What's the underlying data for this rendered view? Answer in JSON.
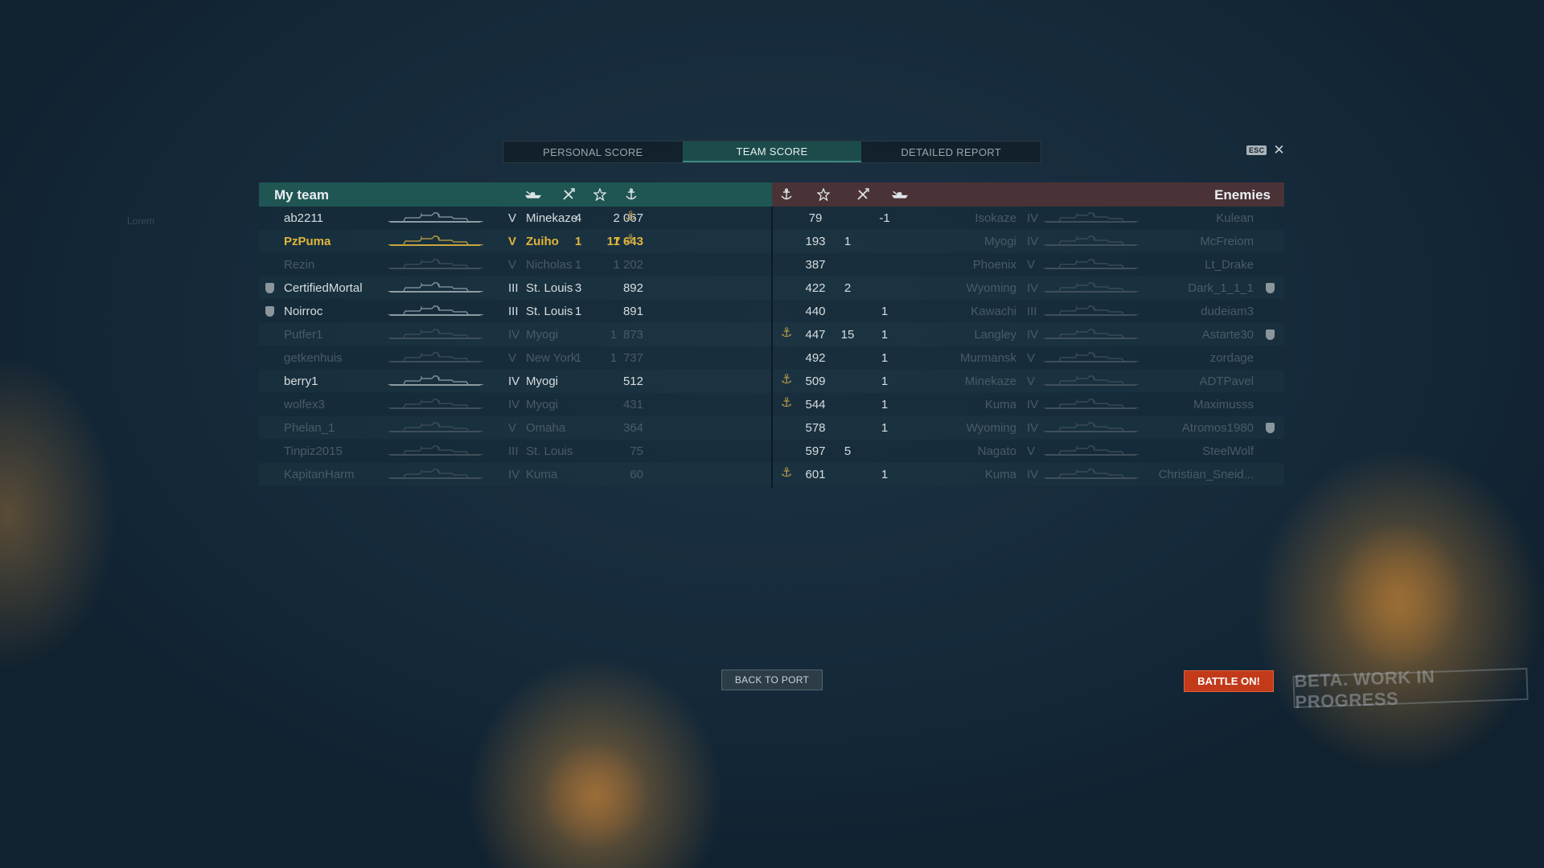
{
  "tabs": [
    {
      "label": "PERSONAL SCORE",
      "active": false
    },
    {
      "label": "TEAM SCORE",
      "active": true
    },
    {
      "label": "DETAILED REPORT",
      "active": false
    }
  ],
  "esc_label": "ESC",
  "close_glyph": "✕",
  "my_team_title": "My team",
  "enemies_title": "Enemies",
  "header_icons": {
    "left": [
      "ship-kills-icon",
      "plane-kills-icon",
      "score-star-icon",
      "base-capture-icon"
    ],
    "right": [
      "base-capture-icon",
      "score-star-icon",
      "plane-kills-icon",
      "ship-kills-icon"
    ]
  },
  "my_team": [
    {
      "player": "ab2211",
      "tier": "V",
      "ship": "Minekaze",
      "kills": "4",
      "planes": "",
      "score": "2 067",
      "anchor": true,
      "dim": false,
      "self": false,
      "shield": false
    },
    {
      "player": "PzPuma",
      "tier": "V",
      "ship": "Zuiho",
      "kills": "1",
      "planes": "17",
      "score": "1 643",
      "anchor": true,
      "dim": false,
      "self": true,
      "shield": false
    },
    {
      "player": "Rezin",
      "tier": "V",
      "ship": "Nicholas",
      "kills": "1",
      "planes": "",
      "score": "1 202",
      "anchor": false,
      "dim": true,
      "self": false,
      "shield": false
    },
    {
      "player": "CertifiedMortal",
      "tier": "III",
      "ship": "St. Louis",
      "kills": "3",
      "planes": "",
      "score": "892",
      "anchor": false,
      "dim": false,
      "self": false,
      "shield": true
    },
    {
      "player": "Noirroc",
      "tier": "III",
      "ship": "St. Louis",
      "kills": "1",
      "planes": "",
      "score": "891",
      "anchor": false,
      "dim": false,
      "self": false,
      "shield": true
    },
    {
      "player": "Putfer1",
      "tier": "IV",
      "ship": "Myogi",
      "kills": "",
      "planes": "1",
      "score": "873",
      "anchor": false,
      "dim": true,
      "self": false,
      "shield": false
    },
    {
      "player": "getkenhuis",
      "tier": "V",
      "ship": "New York",
      "kills": "1",
      "planes": "1",
      "score": "737",
      "anchor": false,
      "dim": true,
      "self": false,
      "shield": false
    },
    {
      "player": "berry1",
      "tier": "IV",
      "ship": "Myogi",
      "kills": "",
      "planes": "",
      "score": "512",
      "anchor": false,
      "dim": false,
      "self": false,
      "shield": false
    },
    {
      "player": "wolfex3",
      "tier": "IV",
      "ship": "Myogi",
      "kills": "",
      "planes": "",
      "score": "431",
      "anchor": false,
      "dim": true,
      "self": false,
      "shield": false
    },
    {
      "player": "Phelan_1",
      "tier": "V",
      "ship": "Omaha",
      "kills": "",
      "planes": "",
      "score": "364",
      "anchor": false,
      "dim": true,
      "self": false,
      "shield": false
    },
    {
      "player": "Tinpiz2015",
      "tier": "III",
      "ship": "St. Louis",
      "kills": "",
      "planes": "",
      "score": "75",
      "anchor": false,
      "dim": true,
      "self": false,
      "shield": false
    },
    {
      "player": "KapitanHarm",
      "tier": "IV",
      "ship": "Kuma",
      "kills": "",
      "planes": "",
      "score": "60",
      "anchor": false,
      "dim": true,
      "self": false,
      "shield": false
    }
  ],
  "enemies": [
    {
      "player": "Kulean",
      "tier": "IV",
      "ship": "Isokaze",
      "kills": "-1",
      "planes": "",
      "score": "79",
      "anchor": false,
      "shield": false
    },
    {
      "player": "McFreiom",
      "tier": "IV",
      "ship": "Myogi",
      "kills": "",
      "planes": "1",
      "score": "193",
      "anchor": false,
      "shield": false
    },
    {
      "player": "Lt_Drake",
      "tier": "V",
      "ship": "Phoenix",
      "kills": "",
      "planes": "",
      "score": "387",
      "anchor": false,
      "shield": false
    },
    {
      "player": "Dark_1_1_1",
      "tier": "IV",
      "ship": "Wyoming",
      "kills": "",
      "planes": "2",
      "score": "422",
      "anchor": false,
      "shield": true
    },
    {
      "player": "dudeiam3",
      "tier": "III",
      "ship": "Kawachi",
      "kills": "1",
      "planes": "",
      "score": "440",
      "anchor": false,
      "shield": false
    },
    {
      "player": "Astarte30",
      "tier": "IV",
      "ship": "Langley",
      "kills": "1",
      "planes": "15",
      "score": "447",
      "anchor": true,
      "shield": true
    },
    {
      "player": "zordage",
      "tier": "V",
      "ship": "Murmansk",
      "kills": "1",
      "planes": "",
      "score": "492",
      "anchor": false,
      "shield": false
    },
    {
      "player": "ADTPavel",
      "tier": "V",
      "ship": "Minekaze",
      "kills": "1",
      "planes": "",
      "score": "509",
      "anchor": true,
      "shield": false
    },
    {
      "player": "Maximusss",
      "tier": "IV",
      "ship": "Kuma",
      "kills": "1",
      "planes": "",
      "score": "544",
      "anchor": true,
      "shield": false
    },
    {
      "player": "Atromos1980",
      "tier": "IV",
      "ship": "Wyoming",
      "kills": "1",
      "planes": "",
      "score": "578",
      "anchor": false,
      "shield": true
    },
    {
      "player": "SteelWolf",
      "tier": "V",
      "ship": "Nagato",
      "kills": "",
      "planes": "5",
      "score": "597",
      "anchor": false,
      "shield": false
    },
    {
      "player": "Christian_Sneid...",
      "tier": "IV",
      "ship": "Kuma",
      "kills": "1",
      "planes": "",
      "score": "601",
      "anchor": true,
      "shield": false
    }
  ],
  "back_to_port_label": "BACK TO PORT",
  "battle_on_label": "BATTLE ON!",
  "beta_label": "BETA. WORK IN PROGRESS",
  "ghost_label": "Lorem",
  "colors": {
    "my_team_header": "#1f5654",
    "enemies_header": "#4a3336",
    "self_player": "#e0b53a",
    "battle_button": "#c23a1a",
    "active_tab": "#1c4b4c"
  }
}
